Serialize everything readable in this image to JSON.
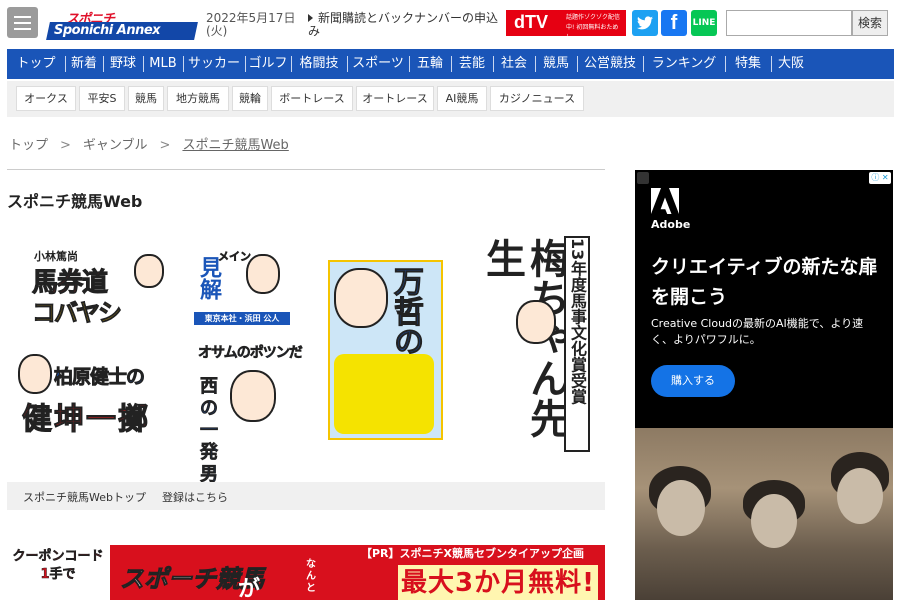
{
  "header": {
    "logo_line1": "スポニチ",
    "logo_line2": "Sponichi Annex",
    "date": "2022年5月17日(火)",
    "subscribe_link": "新聞購読とバックナンバーの申込み",
    "dtv_logo": "dTV",
    "dtv_text": "話題作ゾクゾク配信中! 初回無料おためし",
    "sns": {
      "twitter": "t",
      "facebook": "f",
      "line": "LINE"
    },
    "search_placeholder": "",
    "search_button": "検索"
  },
  "main_nav": [
    "トップ",
    "新着",
    "野球",
    "MLB",
    "サッカー",
    "ゴルフ",
    "格闘技",
    "スポーツ",
    "五輪",
    "芸能",
    "社会",
    "競馬",
    "公営競技",
    "ランキング",
    "特集",
    "大阪"
  ],
  "sub_nav": [
    "オークス",
    "平安S",
    "競馬",
    "地方競馬",
    "競輪",
    "ボートレース",
    "オートレース",
    "AI競馬",
    "カジノニュース"
  ],
  "breadcrumb": {
    "items": [
      "トップ",
      "ギャンブル",
      "スポニチ競馬Web"
    ],
    "separator": ">"
  },
  "page_title": "スポニチ競馬Web",
  "columnists": [
    {
      "small": "小林篤尚",
      "title": "馬券道",
      "sub": "コバヤシ"
    },
    {
      "small": "メイン",
      "title": "見解",
      "sub": "東京本社・浜田 公人"
    },
    {
      "title": "万哲の乱"
    },
    {
      "small": "13年度馬事文化賞受賞",
      "title": "梅ちゃん先生"
    },
    {
      "title": "柏原健士の",
      "sub": "健坤一擲"
    },
    {
      "title": "オサムのポツンだ",
      "sub": "西の一発男"
    }
  ],
  "links_bar": [
    "スポニチ競馬Webトップ",
    "登録はこちら"
  ],
  "pr_banner": {
    "coupon": "クーポンコード 1手で",
    "logo": "スポーチ競馬",
    "ga": "が",
    "nanto": "なんと",
    "top": "【PR】スポニチX競馬セブンタイアップ企画",
    "big": "最大3か月無料!"
  },
  "ad": {
    "brand": "Adobe",
    "headline": "クリエイティブの新たな扉を開こう",
    "desc": "Creative Cloudの最新のAI機能で、より速く、よりパワフルに。",
    "cta": "購入する",
    "adchoice": "ⓘ ✕"
  },
  "colors": {
    "nav_blue": "#1a55b8",
    "accent_red": "#e60012",
    "adobe_blue": "#1473e6"
  }
}
